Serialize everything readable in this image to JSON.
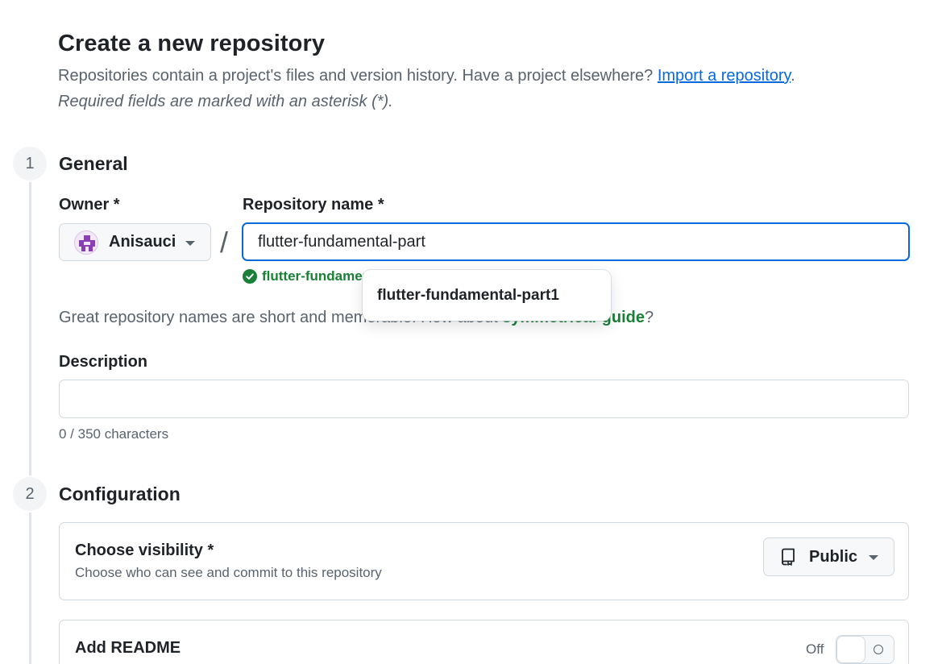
{
  "header": {
    "title": "Create a new repository",
    "subtitle_text": "Repositories contain a project's files and version history. Have a project elsewhere?",
    "import_link": "Import a repository",
    "subtitle_end": ".",
    "required_note": "Required fields are marked with an asterisk (*)."
  },
  "general": {
    "step_number": "1",
    "title": "General",
    "owner_label": "Owner *",
    "owner_value": "Anisauci",
    "repo_label": "Repository name *",
    "repo_value": "flutter-fundamental-part",
    "availability_text": "flutter-fundamental-part is available.",
    "autocomplete_suggestion": "flutter-fundamental-part1",
    "hint_prefix": "Great repository names are short and memorable. How about ",
    "hint_suggestion": "symmetrical-guide",
    "hint_suffix": "?",
    "description_label": "Description",
    "description_value": "",
    "char_count": "0 / 350 characters"
  },
  "configuration": {
    "step_number": "2",
    "title": "Configuration",
    "visibility_title": "Choose visibility *",
    "visibility_desc": "Choose who can see and commit to this repository",
    "visibility_value": "Public",
    "readme_title": "Add README",
    "readme_toggle_label": "Off",
    "readme_enabled": false
  },
  "icons": {
    "owner_avatar": "identicon-avatar",
    "owner_dropdown": "caret-down-icon",
    "availability": "check-circle-icon",
    "visibility": "repo-icon",
    "visibility_dropdown": "caret-down-icon"
  },
  "colors": {
    "accent_blue": "#0969da",
    "success_green": "#1a7f37",
    "text_primary": "#1f2328",
    "text_muted": "#59636e",
    "border": "#d1d9e0",
    "avatar_purple": "#8a3fb5"
  }
}
